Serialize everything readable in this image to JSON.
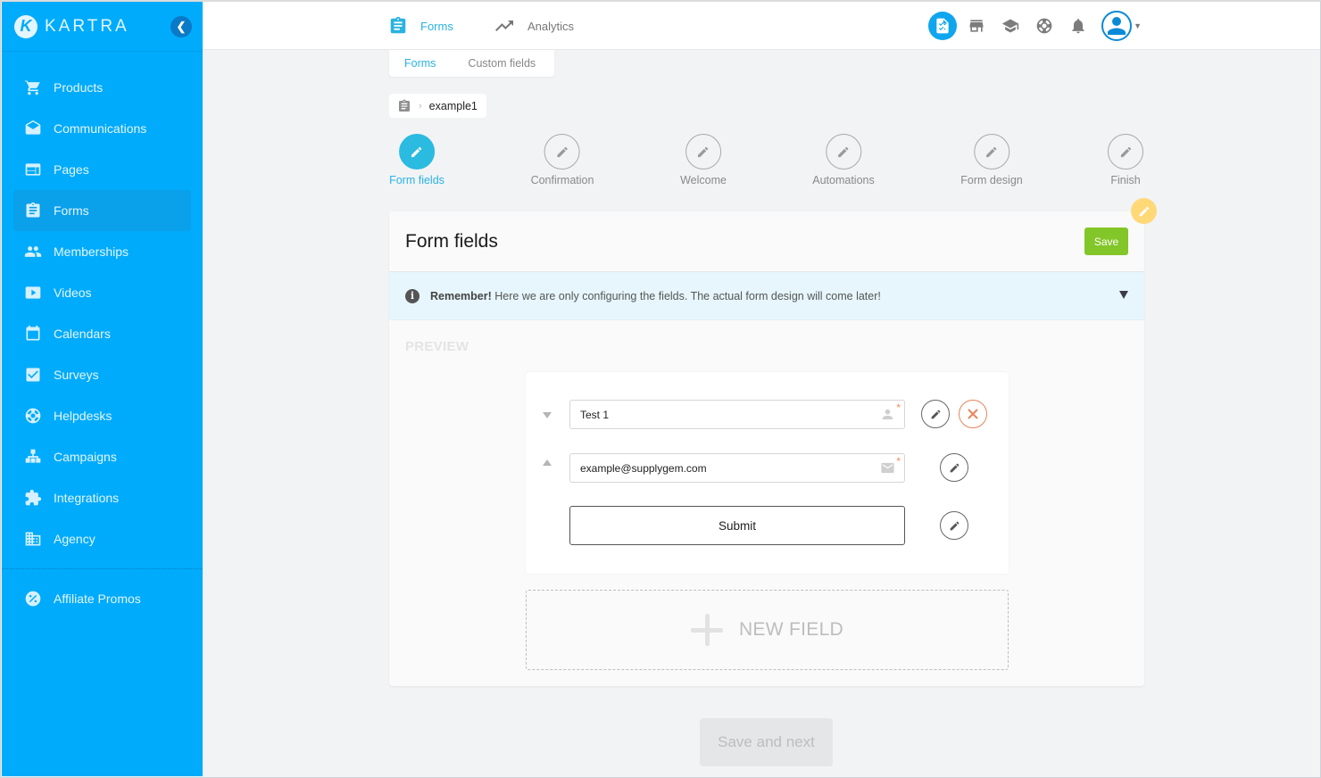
{
  "brand": {
    "name": "KARTRA",
    "logo_letter": "K"
  },
  "sidebar": {
    "collapse_icon": "chevron-left-icon",
    "items": [
      {
        "label": "Products",
        "icon": "cart-icon",
        "active": false
      },
      {
        "label": "Communications",
        "icon": "envelope-open-icon",
        "active": false
      },
      {
        "label": "Pages",
        "icon": "web-page-icon",
        "active": false
      },
      {
        "label": "Forms",
        "icon": "clipboard-icon",
        "active": true
      },
      {
        "label": "Memberships",
        "icon": "people-icon",
        "active": false
      },
      {
        "label": "Videos",
        "icon": "play-icon",
        "active": false
      },
      {
        "label": "Calendars",
        "icon": "calendar-icon",
        "active": false
      },
      {
        "label": "Surveys",
        "icon": "checkbox-icon",
        "active": false
      },
      {
        "label": "Helpdesks",
        "icon": "lifebuoy-icon",
        "active": false
      },
      {
        "label": "Campaigns",
        "icon": "hierarchy-icon",
        "active": false
      },
      {
        "label": "Integrations",
        "icon": "puzzle-icon",
        "active": false
      },
      {
        "label": "Agency",
        "icon": "building-icon",
        "active": false
      }
    ],
    "footer_items": [
      {
        "label": "Affiliate Promos",
        "icon": "percent-badge-icon"
      }
    ]
  },
  "topbar": {
    "tabs": [
      {
        "label": "Forms",
        "icon": "clipboard-icon",
        "active": true
      },
      {
        "label": "Analytics",
        "icon": "trending-up-icon",
        "active": false
      }
    ],
    "icons": [
      "checklist-document-icon",
      "store-icon",
      "graduation-cap-icon",
      "lifebuoy-icon",
      "bell-icon"
    ],
    "user_icon": "user-avatar-icon"
  },
  "subtabs": [
    {
      "label": "Forms",
      "active": true
    },
    {
      "label": "Custom fields",
      "active": false
    }
  ],
  "breadcrumb": {
    "icon": "clipboard-icon",
    "current": "example1"
  },
  "steps": [
    {
      "label": "Form fields",
      "active": true
    },
    {
      "label": "Confirmation",
      "active": false
    },
    {
      "label": "Welcome",
      "active": false
    },
    {
      "label": "Automations",
      "active": false
    },
    {
      "label": "Form design",
      "active": false
    },
    {
      "label": "Finish",
      "active": false
    }
  ],
  "card": {
    "title": "Form fields",
    "save_label": "Save",
    "notice": {
      "bold": "Remember!",
      "text": " Here we are only configuring the fields. The actual form design will come later!"
    },
    "preview_label": "PREVIEW",
    "fields": [
      {
        "value": "Test 1",
        "icon": "user-icon",
        "required": true,
        "deletable": true
      },
      {
        "value": "example@supplygem.com",
        "icon": "envelope-icon",
        "required": true,
        "deletable": false
      }
    ],
    "submit_label": "Submit",
    "new_field_label": "NEW FIELD"
  },
  "footer": {
    "next_label": "Save and next"
  },
  "colors": {
    "sidebar_bg": "#00abfb",
    "accent": "#2bbbe0",
    "save_green": "#83c629",
    "delete_orange": "#e8835a",
    "edit_badge_yellow": "#ffd978"
  }
}
